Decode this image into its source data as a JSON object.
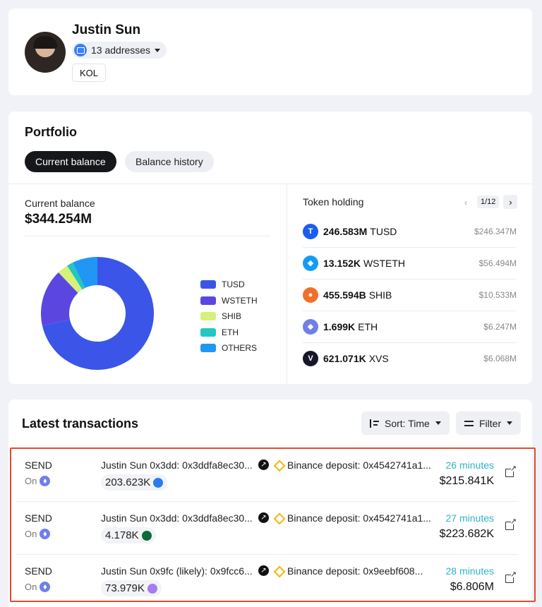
{
  "profile": {
    "name": "Justin Sun",
    "addresses_label": "13 addresses",
    "tag": "KOL"
  },
  "portfolio": {
    "title": "Portfolio",
    "tabs": [
      {
        "label": "Current balance",
        "active": true
      },
      {
        "label": "Balance history",
        "active": false
      }
    ],
    "current_balance_label": "Current balance",
    "current_balance_value": "$344.254M",
    "token_holding": {
      "title": "Token holding",
      "page": "1/12",
      "tokens": [
        {
          "amount": "246.583M",
          "symbol": "TUSD",
          "usd": "$246.347M",
          "icon": "tusd-icon",
          "color": "#1c5cf0"
        },
        {
          "amount": "13.152K",
          "symbol": "WSTETH",
          "usd": "$56.494M",
          "icon": "wsteth-icon",
          "color": "#139df2"
        },
        {
          "amount": "455.594B",
          "symbol": "SHIB",
          "usd": "$10.533M",
          "icon": "shib-icon",
          "color": "#f0702a"
        },
        {
          "amount": "1.699K",
          "symbol": "ETH",
          "usd": "$6.247M",
          "icon": "eth-icon",
          "color": "#6f7fe8"
        },
        {
          "amount": "621.071K",
          "symbol": "XVS",
          "usd": "$6.068M",
          "icon": "xvs-icon",
          "color": "#17172a"
        }
      ]
    }
  },
  "chart_data": {
    "type": "pie",
    "categories": [
      "TUSD",
      "WSTETH",
      "SHIB",
      "ETH",
      "OTHERS"
    ],
    "values": [
      71.5,
      16.4,
      3.1,
      1.8,
      7.2
    ],
    "colors": [
      "#3b55e8",
      "#5b47e0",
      "#d6f07a",
      "#22c8c0",
      "#2196f3"
    ],
    "donut": true,
    "legend": "right"
  },
  "transactions": {
    "title": "Latest transactions",
    "sort_label": "Sort: Time",
    "filter_label": "Filter",
    "rows": [
      {
        "type": "SEND",
        "chain_label": "On",
        "from": "Justin Sun 0x3dd: 0x3ddfa8ec30...",
        "to": "Binance deposit: 0x4542741a1...",
        "amount": "203.623K",
        "amount_icon_color": "#2b7bf0",
        "time": "26 minutes",
        "usd": "$215.841K"
      },
      {
        "type": "SEND",
        "chain_label": "On",
        "from": "Justin Sun 0x3dd: 0x3ddfa8ec30...",
        "to": "Binance deposit: 0x4542741a1...",
        "amount": "4.178K",
        "amount_icon_color": "#0d6b3a",
        "time": "27 minutes",
        "usd": "$223.682K"
      },
      {
        "type": "SEND",
        "chain_label": "On",
        "from": "Justin Sun 0x9fc (likely): 0x9fcc6...",
        "to": "Binance deposit: 0x9eebf608...",
        "amount": "73.979K",
        "amount_icon_color": "#a67cf0",
        "time": "28 minutes",
        "usd": "$6.806M"
      }
    ]
  }
}
